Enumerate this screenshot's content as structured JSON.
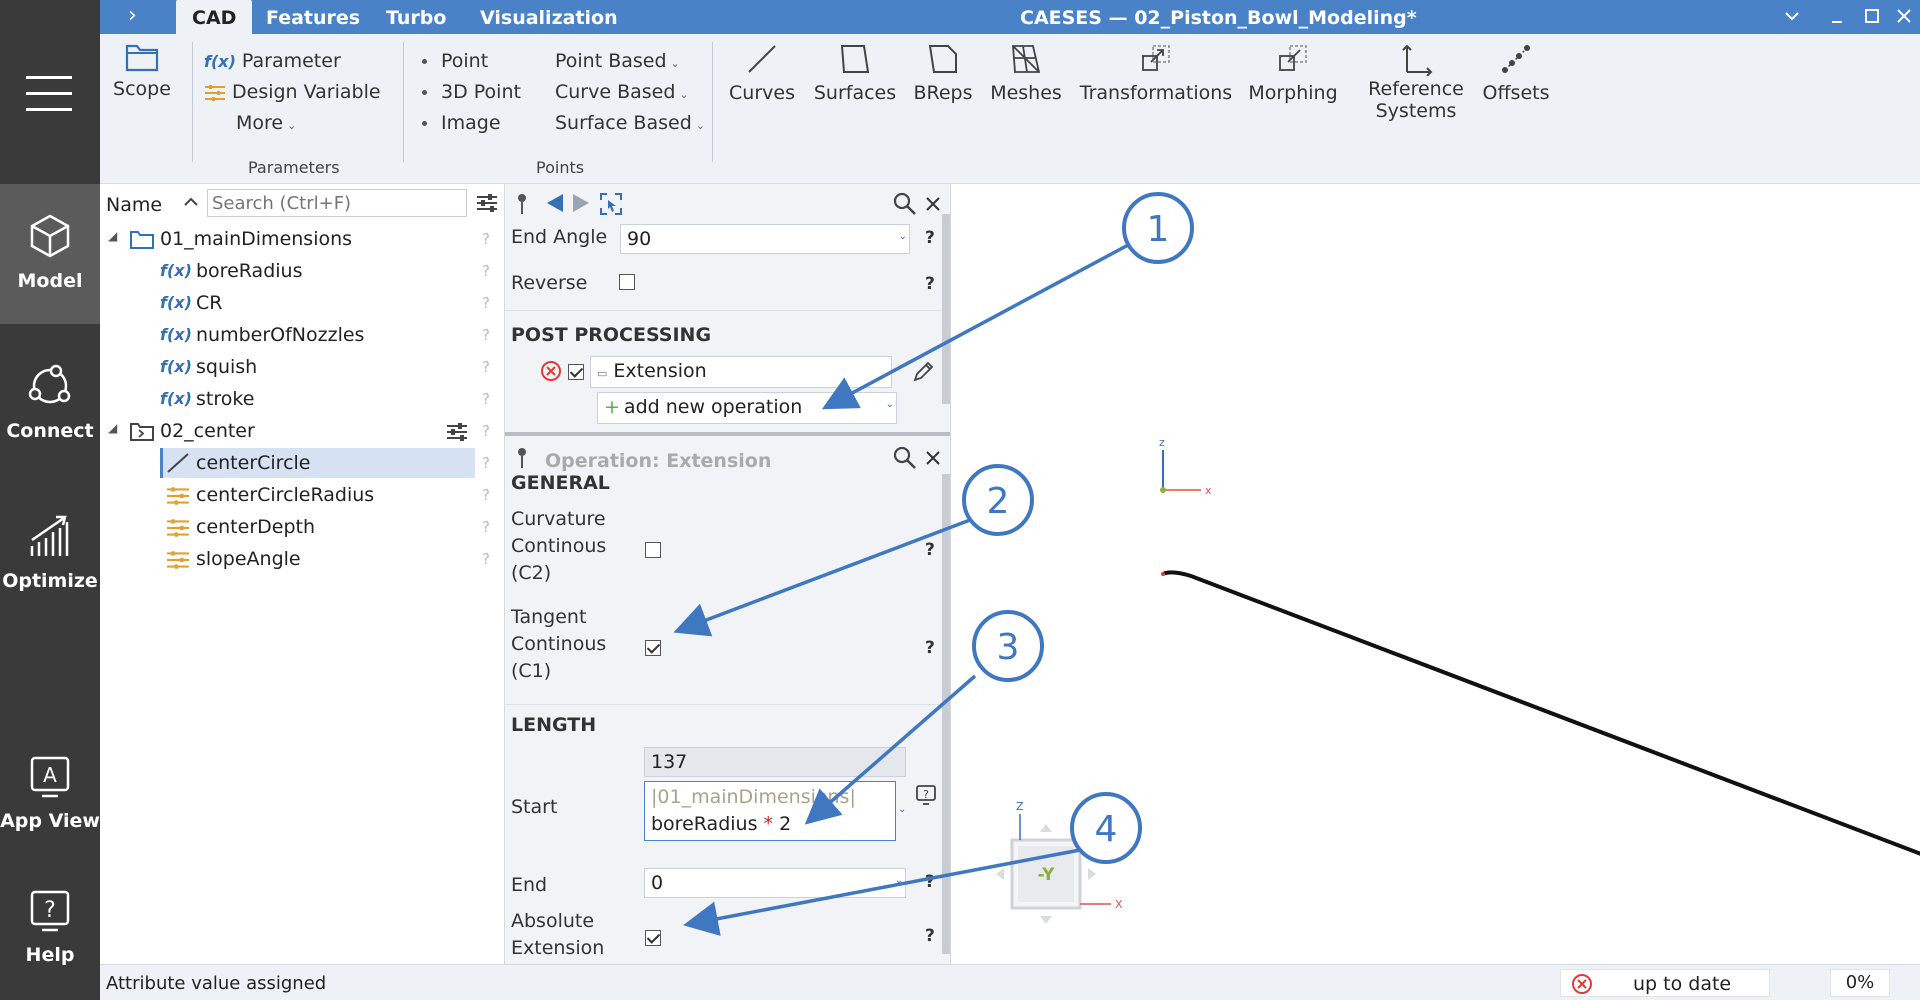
{
  "titlebar": {
    "expand_glyph": "›",
    "tabs": [
      "CAD",
      "Features",
      "Turbo",
      "Visualization"
    ],
    "title": "CAESES — 02_Piston_Bowl_Modeling*",
    "controls": [
      "chevron-down-icon",
      "minimize-icon",
      "maximize-icon",
      "close-icon"
    ]
  },
  "rail": {
    "items": [
      {
        "label": "Model",
        "icon": "cube-icon"
      },
      {
        "label": "Connect",
        "icon": "connect-icon"
      },
      {
        "label": "Optimize",
        "icon": "chart-icon"
      },
      {
        "label": "App View",
        "icon": "app-view-icon"
      },
      {
        "label": "Help",
        "icon": "help-icon"
      }
    ]
  },
  "ribbon": {
    "scope": "Scope",
    "parameter": "Parameter",
    "design_variable": "Design Variable",
    "more": "More",
    "group_parameters": "Parameters",
    "point": "Point",
    "point_3d": "3D Point",
    "image": "Image",
    "point_based": "Point Based",
    "curve_based": "Curve Based",
    "surface_based": "Surface Based",
    "group_points": "Points",
    "curves": "Curves",
    "surfaces": "Surfaces",
    "breps": "BReps",
    "meshes": "Meshes",
    "transformations": "Transformations",
    "morphing": "Morphing",
    "reference_systems_1": "Reference",
    "reference_systems_2": "Systems",
    "offsets": "Offsets",
    "fx_glyph": "f(x)"
  },
  "tree": {
    "name_header": "Name",
    "search_placeholder": "Search (Ctrl+F)",
    "question": "?",
    "rows": [
      {
        "label": "01_mainDimensions",
        "kind": "folder"
      },
      {
        "label": "boreRadius",
        "kind": "fx"
      },
      {
        "label": "CR",
        "kind": "fx"
      },
      {
        "label": "numberOfNozzles",
        "kind": "fx"
      },
      {
        "label": "squish",
        "kind": "fx"
      },
      {
        "label": "stroke",
        "kind": "fx"
      },
      {
        "label": "02_center",
        "kind": "folder"
      },
      {
        "label": "centerCircle",
        "kind": "curve"
      },
      {
        "label": "centerCircleRadius",
        "kind": "dv"
      },
      {
        "label": "centerDepth",
        "kind": "dv"
      },
      {
        "label": "slopeAngle",
        "kind": "dv"
      }
    ]
  },
  "props": {
    "end_angle_label": "End Angle",
    "end_angle_value": "90",
    "reverse_label": "Reverse",
    "post_processing": "POST PROCESSING",
    "extension_label": "Extension",
    "add_new_operation": "add new operation",
    "operation_title": "Operation: Extension",
    "general": "GENERAL",
    "curv_1": "Curvature",
    "curv_2": "Continous",
    "curv_3": "(C2)",
    "tan_1": "Tangent",
    "tan_2": "Continous",
    "tan_3": "(C1)",
    "length": "LENGTH",
    "start_computed": "137",
    "start_label": "Start",
    "start_expr_1": "|01_mainDimensions|",
    "start_expr_2a": "boreRadius ",
    "start_expr_2b": "* ",
    "start_expr_2c": "2",
    "end_label": "End",
    "end_value": "0",
    "abs_1": "Absolute",
    "abs_2": "Extension",
    "question": "?"
  },
  "viewport": {
    "axis_z": "z",
    "axis_x": "x",
    "cube_face": "-Y",
    "cube_z": "Z",
    "cube_x": "X"
  },
  "callouts": [
    "1",
    "2",
    "3",
    "4"
  ],
  "status": {
    "message": "Attribute value assigned",
    "state": "up to date",
    "percent": "0%"
  },
  "colors": {
    "accent": "#4a82c8",
    "rail": "#3a3a3a",
    "callout": "#3f78c0",
    "error": "#e03a3a",
    "dv_icon": "#e0a030"
  }
}
